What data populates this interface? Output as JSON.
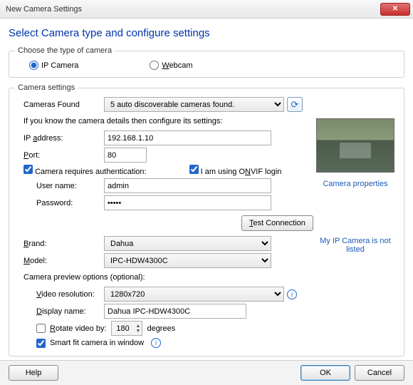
{
  "window": {
    "title": "New Camera Settings"
  },
  "heading": "Select Camera type and configure settings",
  "type_group": {
    "legend": "Choose the type of camera",
    "ip": "IP Camera",
    "webcam": "Webcam"
  },
  "settings_group": {
    "legend": "Camera settings",
    "cameras_found_label": "Cameras Found",
    "cameras_found_value": "5 auto discoverable cameras found.",
    "detail_note": "If you know the camera details then configure its settings:",
    "ip_label": "IP address:",
    "ip_value": "192.168.1.10",
    "port_label": "Port:",
    "port_value": "80",
    "auth_label": "Camera requires authentication:",
    "onvif_label": "I am using ONVIF login",
    "user_label": "User name:",
    "user_value": "admin",
    "pass_label": "Password:",
    "pass_value": "•••••",
    "test_btn": "Test Connection",
    "cam_props_link": "Camera properties",
    "brand_label": "Brand:",
    "brand_value": "Dahua",
    "model_label": "Model:",
    "model_value": "IPC-HDW4300C",
    "not_listed_link": "My IP Camera is not listed",
    "preview_heading": "Camera preview options (optional):",
    "res_label": "Video resolution:",
    "res_value": "1280x720",
    "display_label": "Display name:",
    "display_value": "Dahua IPC-HDW4300C",
    "rotate_label": "Rotate video by:",
    "rotate_value": "180",
    "degrees": "degrees",
    "smartfit_label": "Smart fit camera in window"
  },
  "footer": {
    "help": "Help",
    "ok": "OK",
    "cancel": "Cancel"
  }
}
